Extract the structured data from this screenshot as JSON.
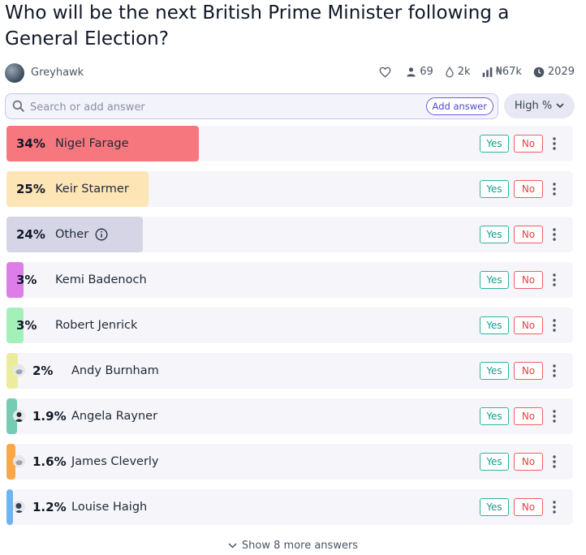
{
  "question": {
    "title": "Who will be the next British Prime Minister following a General Election?"
  },
  "author": {
    "name": "Greyhawk"
  },
  "stats": {
    "traders": "69",
    "liquidity": "2k",
    "volume": "₦67k",
    "close_year": "2029"
  },
  "search": {
    "placeholder": "Search or add answer",
    "add_label": "Add answer"
  },
  "sort": {
    "label": "High %"
  },
  "answers": [
    {
      "pct": "34%",
      "name": "Nigel Farage",
      "value": 0.34,
      "color": "#f7777e"
    },
    {
      "pct": "25%",
      "name": "Keir Starmer",
      "value": 0.25,
      "color": "#fde5b6"
    },
    {
      "pct": "24%",
      "name": "Other",
      "value": 0.24,
      "color": "#d5d5e6"
    },
    {
      "pct": "3%",
      "name": "Kemi Badenoch",
      "value": 0.03,
      "color": "#dd7de8"
    },
    {
      "pct": "3%",
      "name": "Robert Jenrick",
      "value": 0.03,
      "color": "#a3f1b9"
    },
    {
      "pct": "2%",
      "name": "Andy Burnham",
      "value": 0.02,
      "color": "#ecec9c"
    },
    {
      "pct": "1.9%",
      "name": "Angela Rayner",
      "value": 0.019,
      "color": "#74ccb3"
    },
    {
      "pct": "1.6%",
      "name": "James Cleverly",
      "value": 0.016,
      "color": "#f9a845"
    },
    {
      "pct": "1.2%",
      "name": "Louise Haigh",
      "value": 0.012,
      "color": "#6cb4f2"
    }
  ],
  "buttons": {
    "yes": "Yes",
    "no": "No"
  },
  "footer": {
    "show_more": "Show 8 more answers"
  }
}
